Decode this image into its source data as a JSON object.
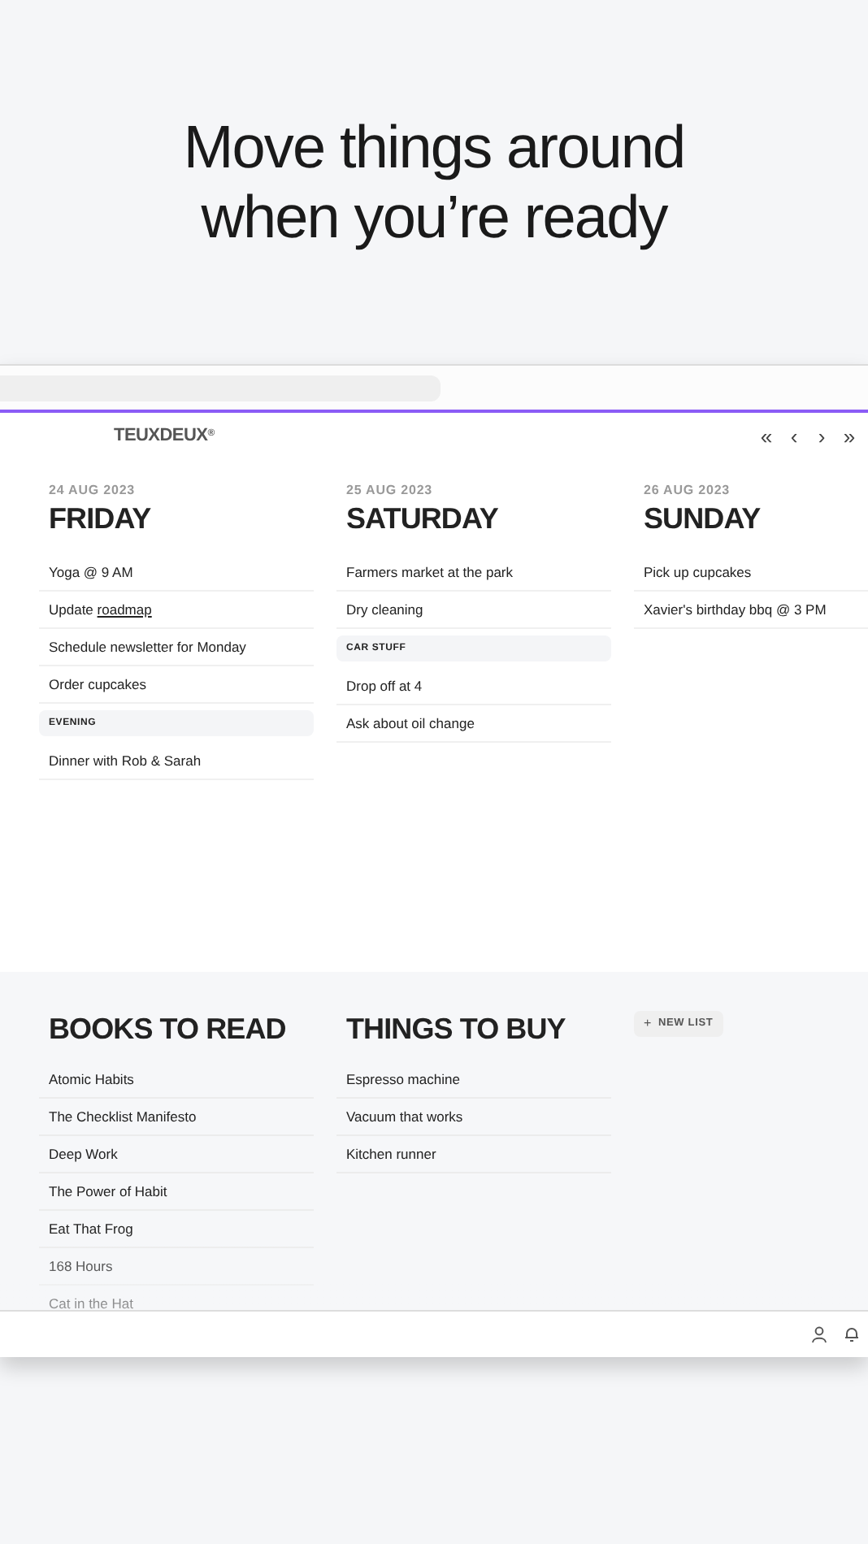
{
  "headline": "Move things around when you’re ready",
  "brand": "TEUXDEUX",
  "brand_mark": "®",
  "nav": [
    "«",
    "‹",
    "›",
    "»"
  ],
  "days": [
    {
      "date": "24 AUG 2023",
      "name": "FRIDAY",
      "items": [
        {
          "kind": "task",
          "text": "Yoga @ 9 AM"
        },
        {
          "kind": "task",
          "text": "Update",
          "link": "roadmap"
        },
        {
          "kind": "task",
          "text": "Schedule newsletter for Monday"
        },
        {
          "kind": "task",
          "text": "Order cupcakes"
        },
        {
          "kind": "header",
          "text": "EVENING"
        },
        {
          "kind": "task",
          "text": "Dinner with Rob & Sarah"
        }
      ]
    },
    {
      "date": "25 AUG 2023",
      "name": "SATURDAY",
      "items": [
        {
          "kind": "task",
          "text": "Farmers market at the park"
        },
        {
          "kind": "task",
          "text": "Dry cleaning"
        },
        {
          "kind": "header",
          "text": "CAR STUFF"
        },
        {
          "kind": "task",
          "text": "Drop off at 4"
        },
        {
          "kind": "task",
          "text": "Ask about oil change"
        }
      ]
    },
    {
      "date": "26 AUG 2023",
      "name": "SUNDAY",
      "items": [
        {
          "kind": "task",
          "text": "Pick up cupcakes"
        },
        {
          "kind": "task",
          "text": "Xavier's birthday bbq @ 3 PM"
        }
      ]
    }
  ],
  "lists": [
    {
      "name": "BOOKS TO READ",
      "items": [
        {
          "text": "Atomic Habits"
        },
        {
          "text": "The Checklist Manifesto"
        },
        {
          "text": "Deep Work"
        },
        {
          "text": "The Power of Habit"
        },
        {
          "text": "Eat That Frog"
        },
        {
          "text": "168 Hours"
        },
        {
          "text": "Cat in the Hat"
        }
      ]
    },
    {
      "name": "THINGS TO BUY",
      "items": [
        {
          "text": "Espresso machine"
        },
        {
          "text": "Vacuum that works"
        },
        {
          "text": "Kitchen runner"
        }
      ]
    }
  ],
  "new_list_button": {
    "icon": "+",
    "label": "NEW LIST"
  }
}
